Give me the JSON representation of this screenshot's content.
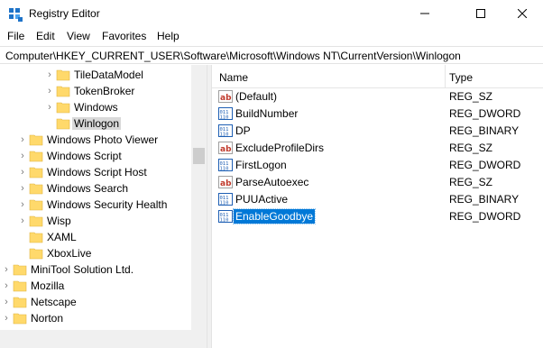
{
  "window": {
    "title": "Registry Editor",
    "minimize_glyph": "—",
    "maximize_glyph": "☐",
    "close_glyph": "✕"
  },
  "menu": [
    "File",
    "Edit",
    "View",
    "Favorites",
    "Help"
  ],
  "address": "Computer\\HKEY_CURRENT_USER\\Software\\Microsoft\\Windows NT\\CurrentVersion\\Winlogon",
  "tree": [
    {
      "label": "TileDataModel",
      "expander": "›",
      "level": 3
    },
    {
      "label": "TokenBroker",
      "expander": "›",
      "level": 3
    },
    {
      "label": "Windows",
      "expander": "›",
      "level": 3
    },
    {
      "label": "Winlogon",
      "expander": "",
      "level": 3,
      "selected": true
    },
    {
      "label": "Windows Photo Viewer",
      "expander": "›",
      "level": 2
    },
    {
      "label": "Windows Script",
      "expander": "›",
      "level": 2
    },
    {
      "label": "Windows Script Host",
      "expander": "›",
      "level": 2
    },
    {
      "label": "Windows Search",
      "expander": "›",
      "level": 2
    },
    {
      "label": "Windows Security Health",
      "expander": "›",
      "level": 2
    },
    {
      "label": "Wisp",
      "expander": "›",
      "level": 2
    },
    {
      "label": "XAML",
      "expander": "",
      "level": 2
    },
    {
      "label": "XboxLive",
      "expander": "",
      "level": 2
    },
    {
      "label": "MiniTool Solution Ltd.",
      "expander": "›",
      "level": 1
    },
    {
      "label": "Mozilla",
      "expander": "›",
      "level": 1
    },
    {
      "label": "Netscape",
      "expander": "›",
      "level": 1
    },
    {
      "label": "Norton",
      "expander": "›",
      "level": 1
    }
  ],
  "list": {
    "columns": {
      "name": "Name",
      "type": "Type"
    },
    "rows": [
      {
        "name": "(Default)",
        "type": "REG_SZ",
        "icon": "string-value-icon"
      },
      {
        "name": "BuildNumber",
        "type": "REG_DWORD",
        "icon": "binary-value-icon"
      },
      {
        "name": "DP",
        "type": "REG_BINARY",
        "icon": "binary-value-icon"
      },
      {
        "name": "ExcludeProfileDirs",
        "type": "REG_SZ",
        "icon": "string-value-icon"
      },
      {
        "name": "FirstLogon",
        "type": "REG_DWORD",
        "icon": "binary-value-icon"
      },
      {
        "name": "ParseAutoexec",
        "type": "REG_SZ",
        "icon": "string-value-icon"
      },
      {
        "name": "PUUActive",
        "type": "REG_BINARY",
        "icon": "binary-value-icon"
      },
      {
        "name": "EnableGoodbye",
        "type": "REG_DWORD",
        "icon": "binary-value-icon",
        "selected": true
      }
    ]
  },
  "colors": {
    "selection": "#0078d7",
    "folder": "#ffd96b",
    "tree_selection": "#d9d9d9"
  }
}
